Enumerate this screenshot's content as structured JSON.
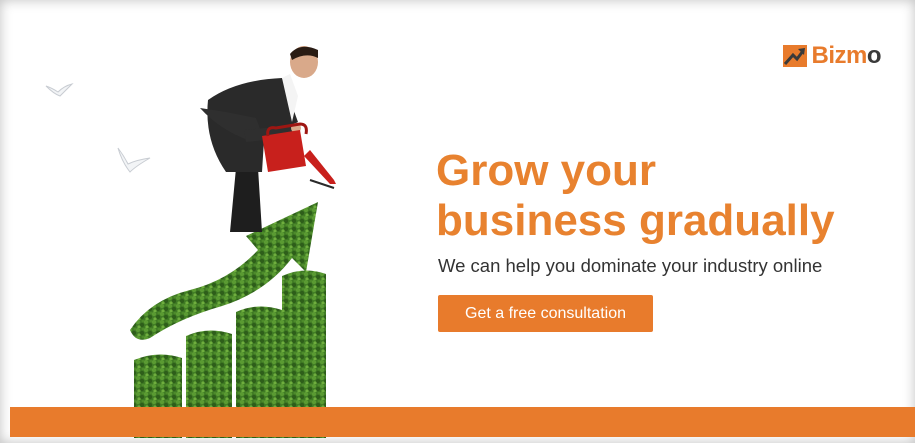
{
  "brand": {
    "logo_text_main": "Bizm",
    "logo_text_end": "o",
    "logo_icon": "trend-arrow-icon",
    "accent_color": "#e87b2c"
  },
  "hero": {
    "headline_line1": "Grow your",
    "headline_line2": "business gradually",
    "subtext": "We can help you dominate your industry online",
    "cta_label": "Get a free consultation"
  },
  "illustration": {
    "subject": "businessman-watering-hedge-growth-chart",
    "elements": [
      "bird-icon",
      "bird-icon",
      "bird-icon",
      "watering-can-icon",
      "hedge-arrow",
      "hedge-bar"
    ]
  }
}
